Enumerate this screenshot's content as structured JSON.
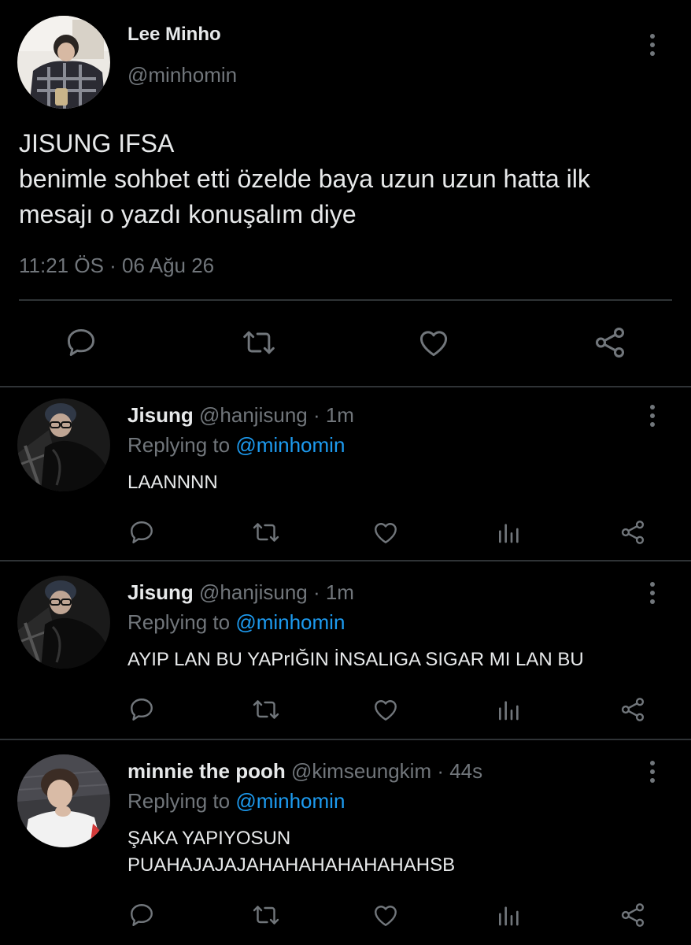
{
  "main_tweet": {
    "author_name": "Lee Minho",
    "author_handle": "@minhomin",
    "text_lines": [
      "JISUNG IFSA",
      "benimle sohbet etti özelde baya uzun uzun hatta ilk",
      "mesajı o yazdı konuşalım diye"
    ],
    "timestamp": "11:21 ÖS · 06 Ağu 26",
    "actions": [
      "reply-icon",
      "retweet-icon",
      "like-icon",
      "share-icon"
    ]
  },
  "replies": [
    {
      "name": "Jisung",
      "handle": "@hanjisung · 1m",
      "replying_prefix": "Replying to",
      "replying_to": "@minhomin",
      "text_lines": [
        "LAANNNN"
      ]
    },
    {
      "name": "Jisung",
      "handle": "@hanjisung · 1m",
      "replying_prefix": "Replying to",
      "replying_to": "@minhomin",
      "text_lines": [
        "AYIP LAN BU YAPrIĞIN İNSALIGA SIGAR MI LAN BU"
      ]
    },
    {
      "name": "minnie the pooh",
      "handle": "@kimseungkim · 44s",
      "replying_prefix": "Replying to",
      "replying_to": "@minhomin",
      "text_lines": [
        "ŞAKA YAPIYOSUN",
        "PUAHAJAJAJAHAHAHAHAHAHAHSB"
      ]
    }
  ],
  "reply_actions": [
    "reply-icon",
    "retweet-icon",
    "like-icon",
    "analytics-icon",
    "share-icon"
  ],
  "colors": {
    "background": "#000000",
    "text": "#e7e9ea",
    "muted": "#71767b",
    "link": "#1d9bf0",
    "divider": "#2f3336"
  }
}
